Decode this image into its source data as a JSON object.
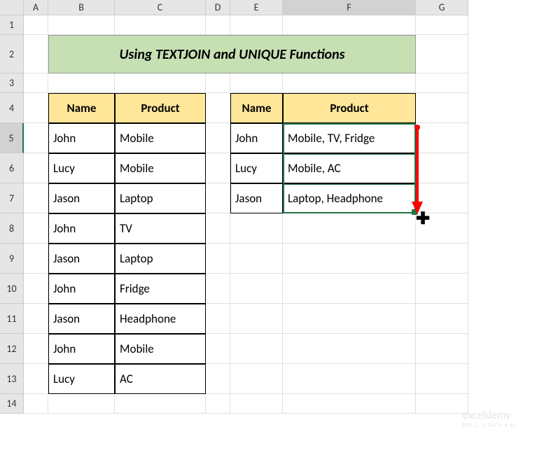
{
  "columns": [
    "A",
    "B",
    "C",
    "D",
    "E",
    "F",
    "G"
  ],
  "rows": [
    "1",
    "2",
    "3",
    "4",
    "5",
    "6",
    "7",
    "8",
    "9",
    "10",
    "11",
    "12",
    "13",
    "14"
  ],
  "title": "Using TEXTJOIN and UNIQUE Functions",
  "table1": {
    "headers": {
      "name": "Name",
      "product": "Product"
    },
    "rows": [
      {
        "name": "John",
        "product": "Mobile"
      },
      {
        "name": "Lucy",
        "product": "Mobile"
      },
      {
        "name": "Jason",
        "product": "Laptop"
      },
      {
        "name": "John",
        "product": "TV"
      },
      {
        "name": "Jason",
        "product": "Laptop"
      },
      {
        "name": "John",
        "product": "Fridge"
      },
      {
        "name": "Jason",
        "product": "Headphone"
      },
      {
        "name": "John",
        "product": "Mobile"
      },
      {
        "name": "Lucy",
        "product": "AC"
      }
    ]
  },
  "table2": {
    "headers": {
      "name": "Name",
      "product": "Product"
    },
    "rows": [
      {
        "name": "John",
        "product": "Mobile, TV, Fridge"
      },
      {
        "name": "Lucy",
        "product": "Mobile, AC"
      },
      {
        "name": "Jason",
        "product": "Laptop, Headphone"
      }
    ]
  },
  "watermark": {
    "brand": "exceldemy",
    "tag": "EXCEL & DATA • BI"
  },
  "selected_row": "5",
  "selected_col": "F"
}
